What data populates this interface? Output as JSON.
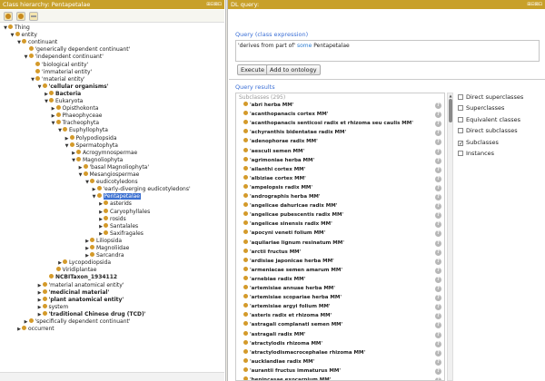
{
  "left_panel": {
    "title": "Class hierarchy: Pentapetalae",
    "header_icons": "⊞⊟⊠⊡",
    "tree": [
      {
        "label": "Thing",
        "depth": 0,
        "expanded": true,
        "bold": false
      },
      {
        "label": "entity",
        "depth": 1,
        "expanded": true,
        "bold": false
      },
      {
        "label": "continuant",
        "depth": 2,
        "expanded": true,
        "bold": false
      },
      {
        "label": "'generically dependent continuant'",
        "depth": 3,
        "expanded": null,
        "bold": false
      },
      {
        "label": "'independent continuant'",
        "depth": 3,
        "expanded": true,
        "bold": false
      },
      {
        "label": "'biological entity'",
        "depth": 4,
        "expanded": null,
        "bold": false
      },
      {
        "label": "'immaterial entity'",
        "depth": 4,
        "expanded": null,
        "bold": false
      },
      {
        "label": "'material entity'",
        "depth": 4,
        "expanded": true,
        "bold": false
      },
      {
        "label": "'cellular organisms'",
        "depth": 5,
        "expanded": true,
        "bold": true
      },
      {
        "label": "Bacteria",
        "depth": 6,
        "expanded": false,
        "bold": true
      },
      {
        "label": "Eukaryota",
        "depth": 6,
        "expanded": true,
        "bold": false
      },
      {
        "label": "Opisthokonta",
        "depth": 7,
        "expanded": false,
        "bold": false
      },
      {
        "label": "Phaeophyceae",
        "depth": 7,
        "expanded": false,
        "bold": false
      },
      {
        "label": "Tracheophyta",
        "depth": 7,
        "expanded": true,
        "bold": false
      },
      {
        "label": "Euphyllophyta",
        "depth": 8,
        "expanded": true,
        "bold": false
      },
      {
        "label": "Polypodiopsida",
        "depth": 9,
        "expanded": false,
        "bold": false
      },
      {
        "label": "Spermatophyta",
        "depth": 9,
        "expanded": true,
        "bold": false
      },
      {
        "label": "Acrogymnospermae",
        "depth": 10,
        "expanded": false,
        "bold": false
      },
      {
        "label": "Magnoliophyta",
        "depth": 10,
        "expanded": true,
        "bold": false
      },
      {
        "label": "'basal Magnoliophyta'",
        "depth": 11,
        "expanded": false,
        "bold": false
      },
      {
        "label": "Mesangiospermae",
        "depth": 11,
        "expanded": true,
        "bold": false
      },
      {
        "label": "eudicotyledons",
        "depth": 12,
        "expanded": true,
        "bold": false
      },
      {
        "label": "'early-diverging eudicotyledons'",
        "depth": 13,
        "expanded": false,
        "bold": false
      },
      {
        "label": "Pentapetalae",
        "depth": 13,
        "expanded": true,
        "bold": false,
        "selected": true
      },
      {
        "label": "asterids",
        "depth": 14,
        "expanded": false,
        "bold": false
      },
      {
        "label": "Caryophyllales",
        "depth": 14,
        "expanded": false,
        "bold": false
      },
      {
        "label": "rosids",
        "depth": 14,
        "expanded": false,
        "bold": false
      },
      {
        "label": "Santalales",
        "depth": 14,
        "expanded": false,
        "bold": false
      },
      {
        "label": "Saxifragales",
        "depth": 14,
        "expanded": false,
        "bold": false
      },
      {
        "label": "Liliopsida",
        "depth": 12,
        "expanded": false,
        "bold": false
      },
      {
        "label": "Magnoliidae",
        "depth": 12,
        "expanded": false,
        "bold": false
      },
      {
        "label": "Sarcandra",
        "depth": 12,
        "expanded": false,
        "bold": false
      },
      {
        "label": "Lycopodiopsida",
        "depth": 8,
        "expanded": false,
        "bold": false
      },
      {
        "label": "Viridiplantae",
        "depth": 7,
        "expanded": null,
        "bold": false
      },
      {
        "label": "NCBITaxon_1934112",
        "depth": 6,
        "expanded": null,
        "bold": true
      },
      {
        "label": "'material anatomical entity'",
        "depth": 5,
        "expanded": false,
        "bold": false
      },
      {
        "label": "'medicinal material'",
        "depth": 5,
        "expanded": false,
        "bold": true
      },
      {
        "label": "'plant anatomical entity'",
        "depth": 5,
        "expanded": false,
        "bold": true
      },
      {
        "label": "system",
        "depth": 5,
        "expanded": false,
        "bold": false
      },
      {
        "label": "'traditional Chinese drug (TCD)'",
        "depth": 5,
        "expanded": false,
        "bold": true
      },
      {
        "label": "'specifically dependent continuant'",
        "depth": 3,
        "expanded": false,
        "bold": false
      },
      {
        "label": "occurrent",
        "depth": 2,
        "expanded": false,
        "bold": false
      }
    ]
  },
  "right_panel": {
    "title": "DL query:",
    "header_icons": "⊞⊟⊠⊡",
    "query_label": "Query (class expression)",
    "query_text_pre": "'derives from part of' ",
    "query_keyword": "some",
    "query_text_post": " Pentapetalae",
    "execute_label": "Execute",
    "add_label": "Add to ontology",
    "results_label": "Query results",
    "subclasses_header": "Subclasses (295)",
    "results": [
      "'abri herba MM'",
      "'acanthopanacis cortex MM'",
      "'acanthopanacis senticosi radix et rhizoma seu caulis MM'",
      "'achyranthis bidentatae radix MM'",
      "'adenophorae radix MM'",
      "'aesculi semen MM'",
      "'agrimoniae herba MM'",
      "'ailanthi cortex MM'",
      "'albiziae cortex MM'",
      "'ampelopsis radix MM'",
      "'andrographis herba MM'",
      "'angelicae dahuricae radix MM'",
      "'angelicae pubescentis radix MM'",
      "'angelicae sinensis radix MM'",
      "'apocyni veneti folium MM'",
      "'aquilariae lignum resinatum MM'",
      "'arctii fructus MM'",
      "'ardisiae japonicae herba MM'",
      "'armeniacae semen amarum MM'",
      "'arnebiae radix MM'",
      "'artemisiae annuae herba MM'",
      "'artemisiae scopariae herba MM'",
      "'artemisiae argyi folium MM'",
      "'asteris radix et rhizoma MM'",
      "'astragali complanati semen MM'",
      "'astragali radix MM'",
      "'atractylodis rhizoma MM'",
      "'atractylodismacrocephalae rhizoma MM'",
      "'aucklandiae radix MM'",
      "'aurantii fructus immaturus MM'",
      "'benincasae exocarpium MM'"
    ],
    "result_icon": "?",
    "options": [
      {
        "label": "Direct superclasses",
        "checked": false
      },
      {
        "label": "Superclasses",
        "checked": false
      },
      {
        "label": "Equivalent classes",
        "checked": false
      },
      {
        "label": "Direct subclasses",
        "checked": false
      },
      {
        "label": "Subclasses",
        "checked": true
      },
      {
        "label": "Instances",
        "checked": false
      }
    ]
  },
  "colors": {
    "header_bg": "#c8a02a",
    "class_dot": "#d49a2a",
    "selection": "#3a6fd0",
    "section_title": "#3b6fd6"
  }
}
